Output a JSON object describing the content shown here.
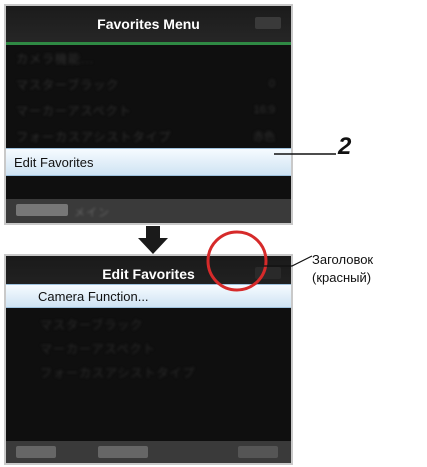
{
  "screen1": {
    "title": "Favorites Menu",
    "items_blurred": [
      "カメラ機能...",
      "マスターブラック",
      "マーカーアスペクト",
      "フォーカスアシストタイプ"
    ],
    "values_blurred": [
      "",
      "0",
      "16:9",
      "赤色"
    ],
    "selected_item": "Edit Favorites",
    "footer_blurred": "メイン"
  },
  "screen2": {
    "title": "Edit Favorites",
    "selected_item": "Camera Function...",
    "items_blurred": [
      "マスターブラック",
      "マーカーアスペクト",
      "フォーカスアシストタイプ"
    ]
  },
  "callouts": {
    "step_number": "2",
    "header_label_line1": "Заголовок",
    "header_label_line2": "(красный)"
  },
  "colors": {
    "menu_title_underline": "#2f8a44",
    "edit_title_underline": "#7c2a6a",
    "circle": "#d62a2a"
  }
}
